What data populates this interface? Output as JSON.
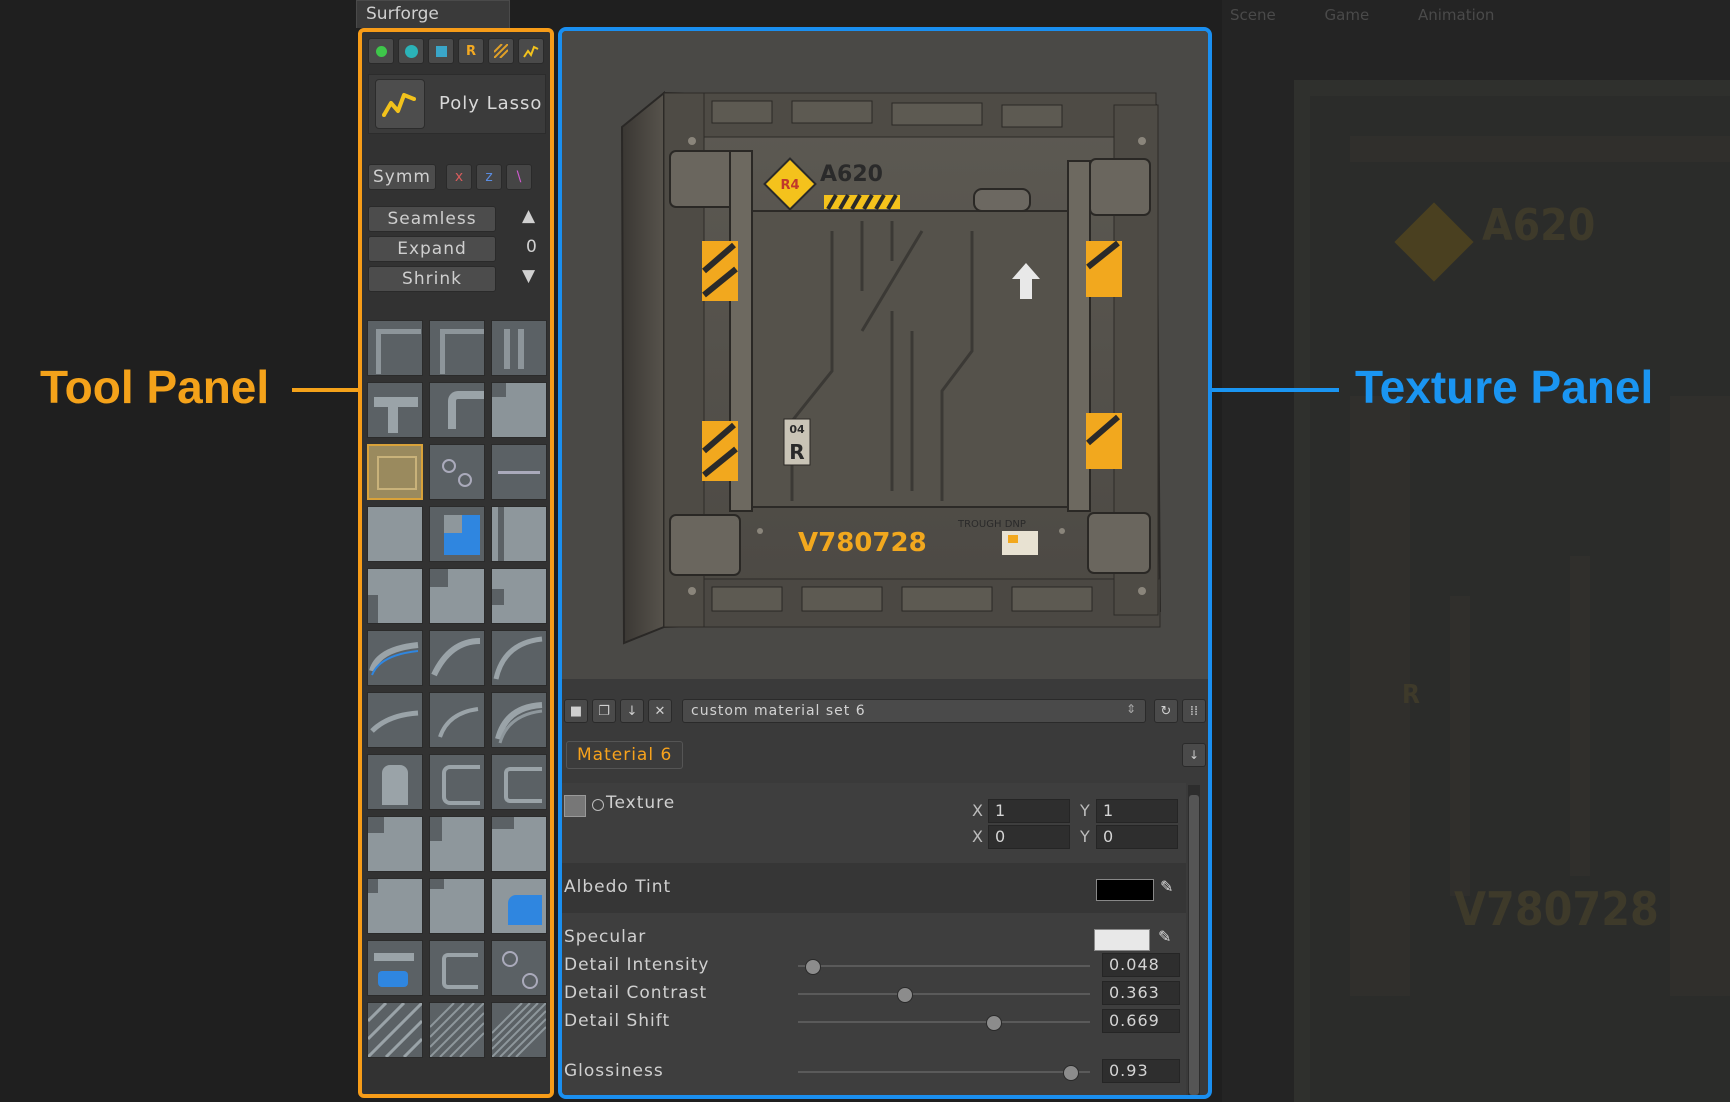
{
  "callouts": {
    "tool_panel": "Tool Panel",
    "texture_panel": "Texture Panel",
    "tool_color": "#f4a21a",
    "texture_color": "#1a95f2"
  },
  "window": {
    "tab_title": "Surforge"
  },
  "tool_panel": {
    "mode_icons": [
      "green-dot-icon",
      "teal-sphere-icon",
      "cube-icon",
      "r-mode-icon",
      "hatch-icon",
      "poly-lasso-small-icon"
    ],
    "mode_r_label": "R",
    "current_tool": "Poly Lasso",
    "symmetry": {
      "label": "Symm",
      "x": "x",
      "z": "z",
      "diag": "\\"
    },
    "seamless_label": "Seamless",
    "expand_label": "Expand",
    "expand_value": "0",
    "shrink_label": "Shrink"
  },
  "texture_panel": {
    "crate": {
      "code": "A620",
      "badge": "R4",
      "serial": "V780728",
      "side_tag_top": "04",
      "side_tag_letter": "R",
      "sticker_text": "TROUGH DNP"
    },
    "material_set": "custom material set 6",
    "material_tab": "Material 6",
    "texture": {
      "label": "Texture",
      "tiling": {
        "x_label": "X",
        "x": "1",
        "y_label": "Y",
        "y": "1"
      },
      "offset": {
        "x_label": "X",
        "x": "0",
        "y_label": "Y",
        "y": "0"
      }
    },
    "albedo_tint": {
      "label": "Albedo Tint",
      "color": "#000000"
    },
    "specular": {
      "label": "Specular",
      "color": "#e8e8e8"
    },
    "sliders": [
      {
        "label": "Detail Intensity",
        "display": "0.048",
        "value": 0.048
      },
      {
        "label": "Detail Contrast",
        "display": "0.363",
        "value": 0.363
      },
      {
        "label": "Detail Shift",
        "display": "0.669",
        "value": 0.669
      },
      {
        "label": "Glossiness",
        "display": "0.93",
        "value": 0.93
      }
    ]
  },
  "background_window": {
    "tabs": [
      "Scene",
      "Game",
      "Animation"
    ]
  }
}
